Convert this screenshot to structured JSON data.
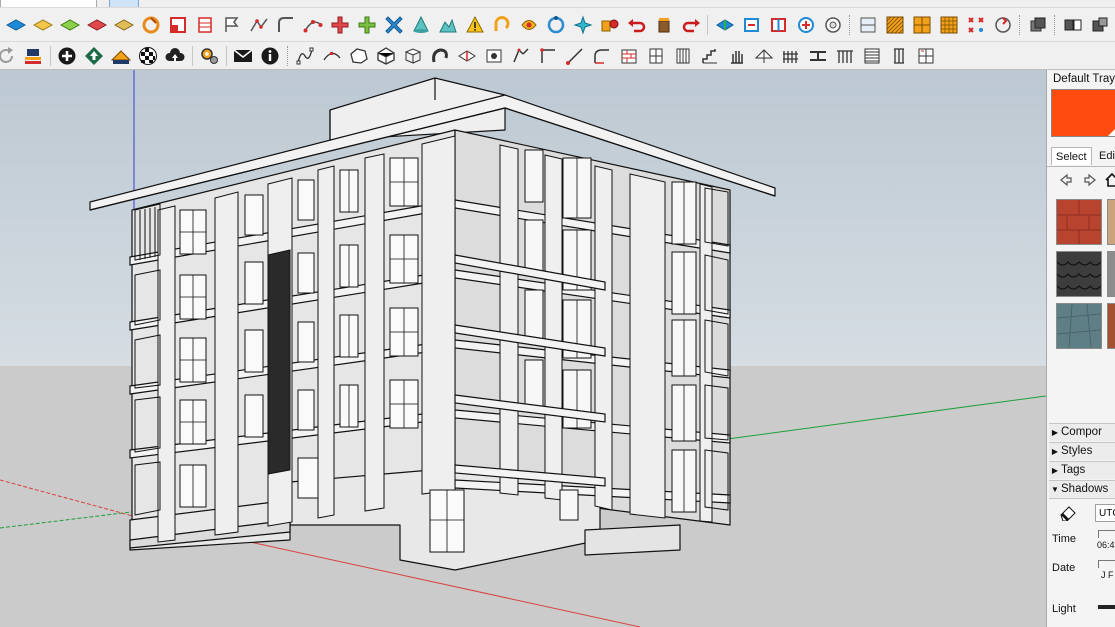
{
  "tray": {
    "title": "Default Tray",
    "accent_color": "#ff4a10",
    "tabs": [
      {
        "label": "Select"
      },
      {
        "label": "Edit"
      }
    ],
    "panels": [
      {
        "label": "Compor",
        "state": "collapsed"
      },
      {
        "label": "Styles",
        "state": "collapsed"
      },
      {
        "label": "Tags",
        "state": "collapsed"
      },
      {
        "label": "Shadows",
        "state": "expanded"
      }
    ],
    "shadows": {
      "utc_label": "UTC",
      "time_label": "Time",
      "time_value": "06:4",
      "date_label": "Date",
      "date_value": "J F",
      "light_label": "Light"
    },
    "materials": [
      "red-brick-material",
      "tan-material",
      "roof-shingle-material",
      "stone-material",
      "blue-stone-material",
      "rust-material"
    ]
  },
  "toolbars": {
    "row1_icons": [
      "3d-text-icon",
      "section-plane-icon",
      "component-icon",
      "material-icon",
      "push-pull-icon",
      "follow-me-icon",
      "flip-icon",
      "rotate-icon",
      "move-icon",
      "axes-icon",
      "protractor-icon",
      "warning-icon",
      "curve-icon",
      "select-icon",
      "connect-icon",
      "orbit-icon",
      "undo-icon",
      "redo-icon",
      "paint-icon",
      "cut-icon",
      "solid-icon",
      "shell-icon",
      "grid-icon",
      "array-icon"
    ],
    "row2_icons": [
      "refresh-icon",
      "export-icon",
      "add-icon",
      "upload-icon",
      "layers-icon",
      "checker-icon",
      "cloud-icon",
      "settings-icon",
      "mail-icon",
      "info-icon",
      "spline-icon",
      "arc-icon",
      "polygon-icon",
      "sandbox-icon",
      "extrude-icon",
      "offset-icon",
      "chamfer-icon",
      "corner-icon",
      "line-icon",
      "fillet-icon",
      "wall-icon",
      "window-icon",
      "door-icon",
      "stair-icon",
      "hand-icon",
      "roof-icon",
      "fence-icon",
      "beam-icon"
    ]
  },
  "viewport": {
    "sky_color": "#c9d3dc",
    "ground_color": "#cbcbcb",
    "model": "apartment-building-model"
  }
}
